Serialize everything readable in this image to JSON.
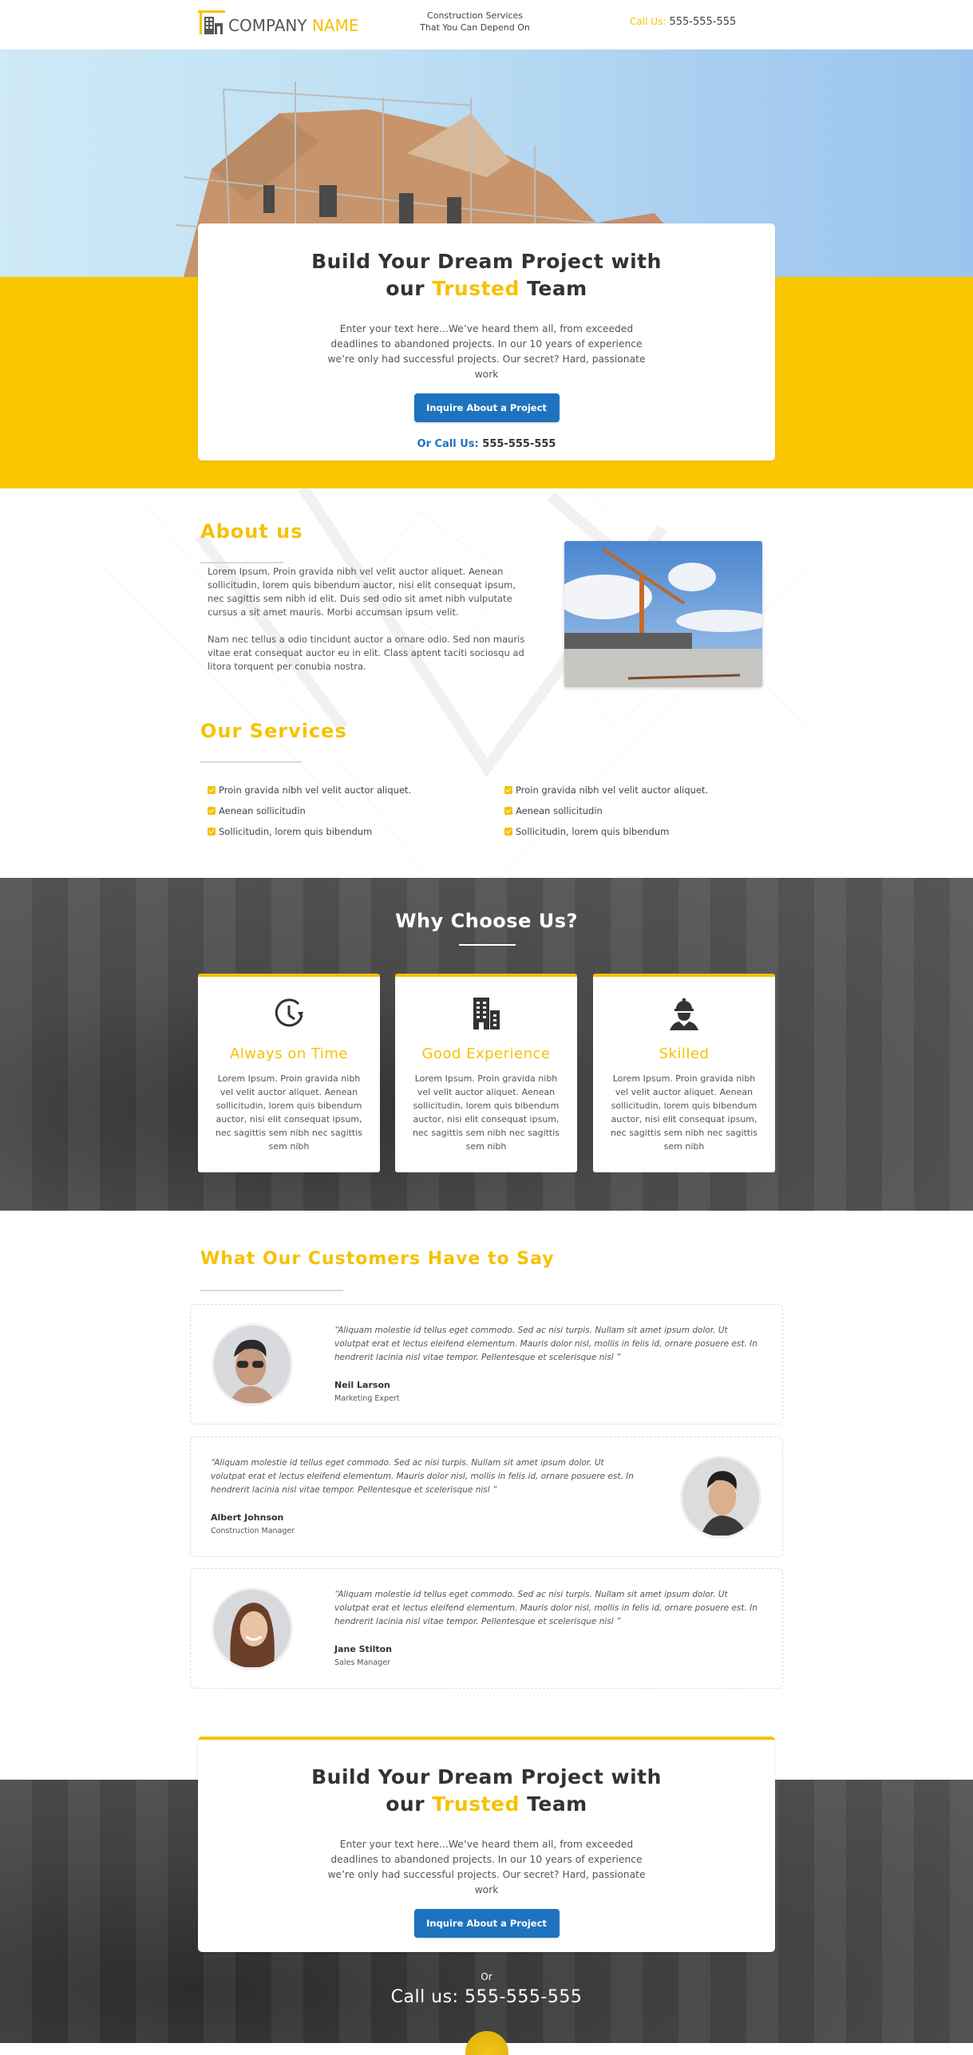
{
  "header": {
    "logo_part1": "COMPANY",
    "logo_part2": "NAME",
    "tagline_line1": "Construction Services",
    "tagline_line2": "That You Can Depend On",
    "call_label": "Call Us:",
    "call_number": "555-555-555"
  },
  "colors": {
    "accent_yellow": "#f6c103",
    "band_yellow": "#fac600",
    "button_blue": "#1e73be",
    "dark_text": "#333333"
  },
  "hero": {
    "title_line1": "Build Your Dream Project with",
    "title_pre": "our",
    "title_highlight": "Trusted",
    "title_post": "Team",
    "text": "Enter your text here...We’ve heard them all, from exceeded deadlines to abandoned projects. In our 10 years of experience we’re only had successful projects. Our secret? Hard, passionate work",
    "button": "Inquire About a Project",
    "call_label": "Or Call Us:",
    "call_number": "555-555-555"
  },
  "about": {
    "title": "About us",
    "paragraphs": [
      "Lorem Ipsum. Proin gravida nibh vel velit auctor aliquet. Aenean sollicitudin, lorem quis bibendum auctor, nisi elit consequat ipsum, nec sagittis sem nibh id elit. Duis sed odio sit amet nibh vulputate cursus a sit amet mauris. Morbi accumsan ipsum velit.",
      "Nam nec tellus a odio tincidunt auctor a ornare odio. Sed non mauris vitae erat consequat auctor eu in elit. Class aptent taciti sociosqu ad litora torquent per conubia nostra."
    ],
    "image_alt": "construction-crane-site"
  },
  "services": {
    "title": "Our Services",
    "col1": [
      "Proin gravida nibh vel velit auctor aliquet.",
      "Aenean sollicitudin",
      "Sollicitudin, lorem quis bibendum"
    ],
    "col2": [
      "Proin gravida nibh vel velit auctor aliquet.",
      "Aenean sollicitudin",
      "Sollicitudin, lorem quis bibendum"
    ]
  },
  "why": {
    "title": "Why Choose Us?",
    "cards": [
      {
        "icon": "clock-icon",
        "title": "Always on Time",
        "text": "Lorem Ipsum. Proin gravida nibh vel velit auctor aliquet. Aenean sollicitudin, lorem quis bibendum auctor, nisi elit consequat ipsum, nec sagittis sem nibh nec sagittis sem nibh"
      },
      {
        "icon": "building-icon",
        "title": "Good Experience",
        "text": "Lorem Ipsum. Proin gravida nibh vel velit auctor aliquet. Aenean sollicitudin, lorem quis bibendum auctor, nisi elit consequat ipsum, nec sagittis sem nibh nec sagittis sem nibh"
      },
      {
        "icon": "worker-icon",
        "title": "Skilled",
        "text": "Lorem Ipsum. Proin gravida nibh vel velit auctor aliquet. Aenean sollicitudin, lorem quis bibendum auctor, nisi elit consequat ipsum, nec sagittis sem nibh nec sagittis sem nibh"
      }
    ]
  },
  "testimonials": {
    "title": "What Our Customers Have to Say",
    "items": [
      {
        "quote": "“Aliquam molestie id tellus eget commodo. Sed ac nisi turpis. Nullam sit amet ipsum dolor. Ut volutpat erat et lectus eleifend elementum. Mauris dolor nisl, mollis in felis id, ornare posuere est. In hendrerit lacinia nisl vitae tempor. Pellentesque et scelerisque nisl ”",
        "name": "Neil Larson",
        "role": "Marketing Expert"
      },
      {
        "quote": "“Aliquam molestie id tellus eget commodo. Sed ac nisi turpis. Nullam sit amet ipsum dolor. Ut volutpat erat et lectus eleifend elementum. Mauris dolor nisl, mollis in felis id, ornare posuere est. In hendrerit lacinia nisl vitae tempor. Pellentesque et scelerisque nisl ”",
        "name": "Albert Johnson",
        "role": "Construction Manager"
      },
      {
        "quote": "“Aliquam molestie id tellus eget commodo. Sed ac nisi turpis. Nullam sit amet ipsum dolor. Ut volutpat erat et lectus eleifend elementum. Mauris dolor nisl, mollis in felis id, ornare posuere est. In hendrerit lacinia nisl vitae tempor. Pellentesque et scelerisque nisl ”",
        "name": "Jane Stilton",
        "role": "Sales Manager"
      }
    ]
  },
  "cta": {
    "title_line1": "Build Your Dream Project with",
    "title_pre": "our",
    "title_highlight": "Trusted",
    "title_post": "Team",
    "text": "Enter your text here...We’ve heard them all, from exceeded deadlines to abandoned projects. In our 10 years of experience we’re only had successful projects. Our secret? Hard, passionate work",
    "button": "Inquire About a Project"
  },
  "footer": {
    "or": "Or",
    "call": "Call us: 555-555-555"
  }
}
